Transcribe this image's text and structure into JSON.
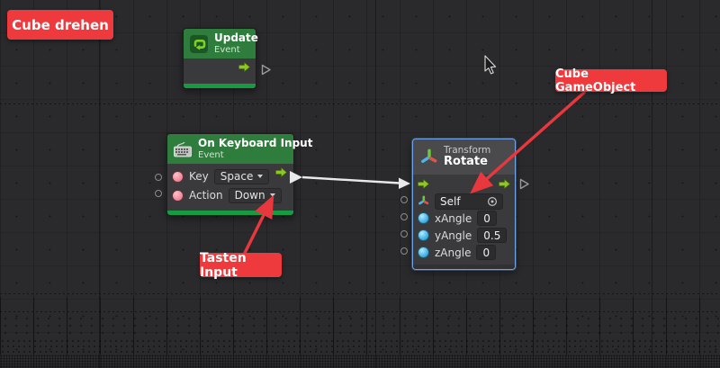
{
  "graph": {
    "background_color": "#2a2a2d",
    "wire_color": "#e9e9e9",
    "selection_color": "#6da3e8",
    "flow_arrow_color": "#8dc81f",
    "port_pink_color": "#ef8392",
    "port_blue_color": "#2fa8e0",
    "event_header_color": "#2e7d3d",
    "event_footer_color": "#169a43"
  },
  "annotation": {
    "bg_color": "#ee3a3c",
    "labels": {
      "cube_drehen": "Cube drehen",
      "cube_gameobject": "Cube GameObject",
      "tasten_input": "Tasten Input"
    }
  },
  "nodes": {
    "update": {
      "title": "Update",
      "subtitle": "Event"
    },
    "keyboard": {
      "title": "On Keyboard Input",
      "subtitle": "Event",
      "rows": [
        {
          "label": "Key",
          "value": "Space"
        },
        {
          "label": "Action",
          "value": "Down"
        }
      ]
    },
    "rotate": {
      "category": "Transform",
      "title": "Rotate",
      "target_label": "Self",
      "params": [
        {
          "label": "xAngle",
          "value": "0"
        },
        {
          "label": "yAngle",
          "value": "0.5"
        },
        {
          "label": "zAngle",
          "value": "0"
        }
      ]
    }
  }
}
